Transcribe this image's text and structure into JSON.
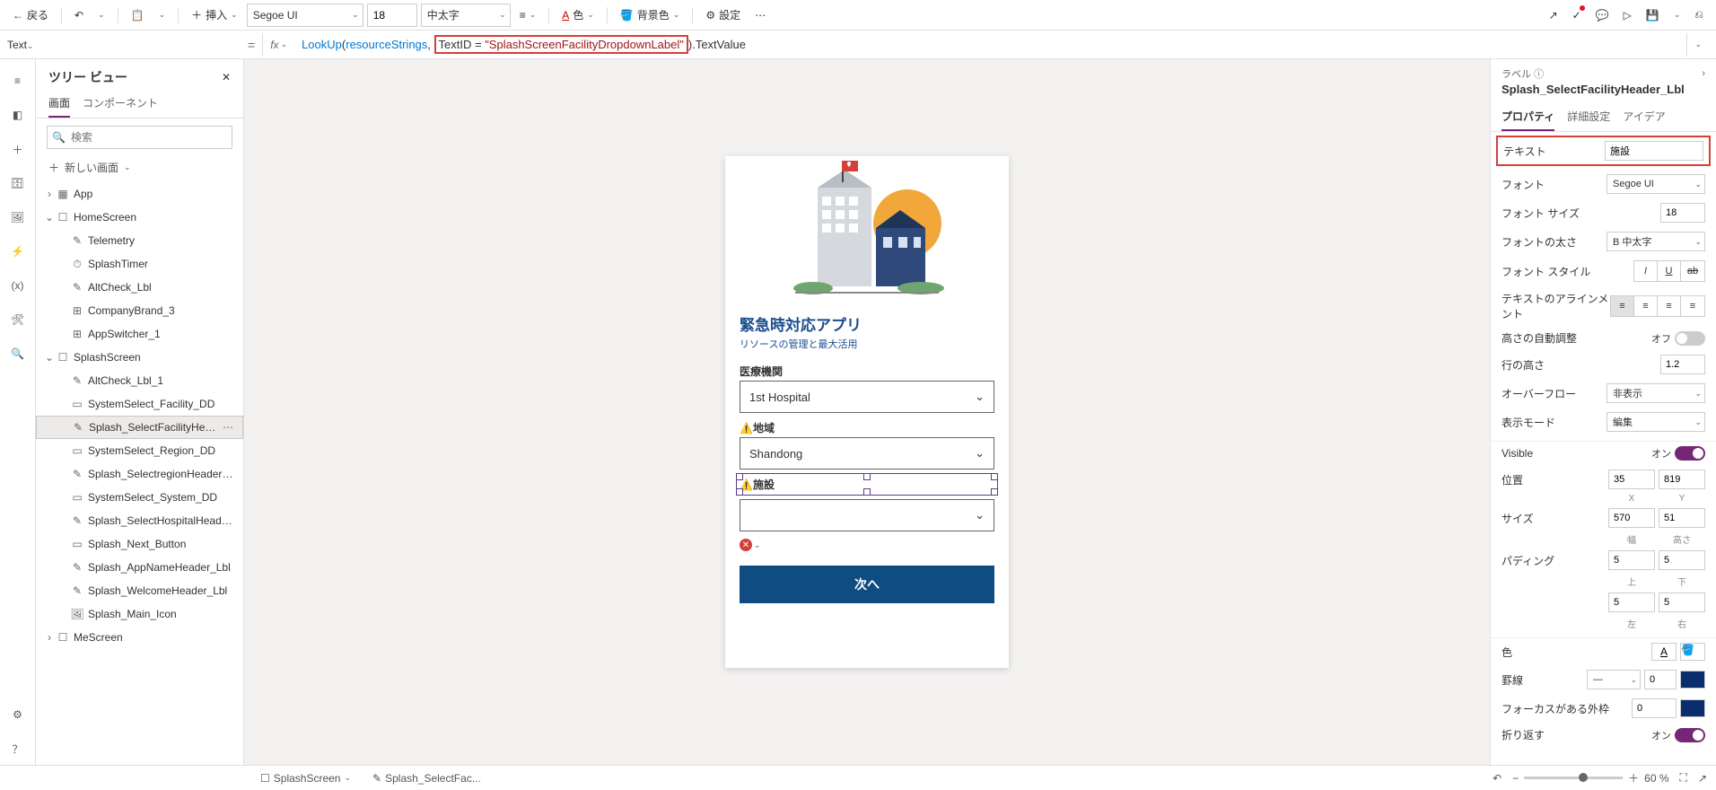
{
  "topbar": {
    "back": "戻る",
    "insert": "挿入",
    "font_family": "Segoe UI",
    "font_size": "18",
    "font_weight": "中太字",
    "color": "色",
    "bgcolor": "背景色",
    "settings": "設定"
  },
  "fxbar": {
    "property": "Text",
    "fx": "fx",
    "formula_lookup": "LookUp",
    "formula_param1": "resourceStrings",
    "formula_textid": "TextID",
    "formula_eq": " = ",
    "formula_str": "\"SplashScreenFacilityDropdownLabel\"",
    "formula_tail": ".TextValue"
  },
  "leftpanel": {
    "title": "ツリー ビュー",
    "tab_screens": "画面",
    "tab_components": "コンポーネント",
    "search_placeholder": "検索",
    "new_screen": "新しい画面",
    "nodes": [
      {
        "d": 0,
        "ex": "›",
        "ic": "app",
        "lbl": "App"
      },
      {
        "d": 0,
        "ex": "⌄",
        "ic": "screen",
        "lbl": "HomeScreen"
      },
      {
        "d": 1,
        "ex": "",
        "ic": "label",
        "lbl": "Telemetry"
      },
      {
        "d": 1,
        "ex": "",
        "ic": "timer",
        "lbl": "SplashTimer"
      },
      {
        "d": 1,
        "ex": "",
        "ic": "label",
        "lbl": "AltCheck_Lbl"
      },
      {
        "d": 1,
        "ex": "",
        "ic": "comp",
        "lbl": "CompanyBrand_3"
      },
      {
        "d": 1,
        "ex": "",
        "ic": "comp",
        "lbl": "AppSwitcher_1"
      },
      {
        "d": 0,
        "ex": "⌄",
        "ic": "screen",
        "lbl": "SplashScreen"
      },
      {
        "d": 1,
        "ex": "",
        "ic": "label",
        "lbl": "AltCheck_Lbl_1"
      },
      {
        "d": 1,
        "ex": "",
        "ic": "dd",
        "lbl": "SystemSelect_Facility_DD"
      },
      {
        "d": 1,
        "ex": "",
        "ic": "label",
        "lbl": "Splash_SelectFacilityHeader_Lbl",
        "sel": true
      },
      {
        "d": 1,
        "ex": "",
        "ic": "dd",
        "lbl": "SystemSelect_Region_DD"
      },
      {
        "d": 1,
        "ex": "",
        "ic": "label",
        "lbl": "Splash_SelectregionHeader_Lbl"
      },
      {
        "d": 1,
        "ex": "",
        "ic": "dd",
        "lbl": "SystemSelect_System_DD"
      },
      {
        "d": 1,
        "ex": "",
        "ic": "label",
        "lbl": "Splash_SelectHospitalHeader_Lbl"
      },
      {
        "d": 1,
        "ex": "",
        "ic": "btn",
        "lbl": "Splash_Next_Button"
      },
      {
        "d": 1,
        "ex": "",
        "ic": "label",
        "lbl": "Splash_AppNameHeader_Lbl"
      },
      {
        "d": 1,
        "ex": "",
        "ic": "label",
        "lbl": "Splash_WelcomeHeader_Lbl"
      },
      {
        "d": 1,
        "ex": "",
        "ic": "img",
        "lbl": "Splash_Main_Icon"
      },
      {
        "d": 0,
        "ex": "›",
        "ic": "screen",
        "lbl": "MeScreen"
      }
    ]
  },
  "phone": {
    "app_title": "緊急時対応アプリ",
    "app_subtitle": "リソースの管理と最大活用",
    "field_hospital": "医療機関",
    "val_hospital": "1st Hospital",
    "field_region": "地域",
    "val_region": "Shandong",
    "field_facility": "施設",
    "val_facility": "",
    "next": "次へ"
  },
  "rightpanel": {
    "type": "ラベル",
    "ctl_name": "Splash_SelectFacilityHeader_Lbl",
    "tab_props": "プロパティ",
    "tab_adv": "詳細設定",
    "tab_ideas": "アイデア",
    "r_text": "テキスト",
    "v_text": "施設",
    "r_font": "フォント",
    "v_font": "Segoe UI",
    "r_size": "フォント サイズ",
    "v_size": "18",
    "r_weight": "フォントの太さ",
    "v_weight": "B 中太字",
    "r_style": "フォント スタイル",
    "r_align": "テキストのアラインメント",
    "r_autoheight": "高さの自動調整",
    "v_autoheight": "オフ",
    "r_lineheight": "行の高さ",
    "v_lineheight": "1.2",
    "r_overflow": "オーバーフロー",
    "v_overflow": "非表示",
    "r_displaymode": "表示モード",
    "v_displaymode": "編集",
    "r_visible": "Visible",
    "v_visible": "オン",
    "r_pos": "位置",
    "v_x": "35",
    "v_y": "819",
    "l_x": "X",
    "l_y": "Y",
    "r_sizerc": "サイズ",
    "v_w": "570",
    "v_h": "51",
    "l_w": "幅",
    "l_h": "高さ",
    "r_padding": "パディング",
    "v_pt": "5",
    "v_pr": "5",
    "v_pb": "5",
    "v_pl": "5",
    "l_top": "上",
    "l_bottom": "下",
    "l_left": "左",
    "l_right": "右",
    "r_color": "色",
    "r_border": "罫線",
    "v_border_w": "0",
    "r_focusborder": "フォーカスがある外枠",
    "v_focusborder": "0",
    "r_wrap": "折り返す",
    "v_wrap": "オン"
  },
  "statusbar": {
    "screen": "SplashScreen",
    "crumb": "Splash_SelectFac...",
    "zoom": "60 %"
  }
}
